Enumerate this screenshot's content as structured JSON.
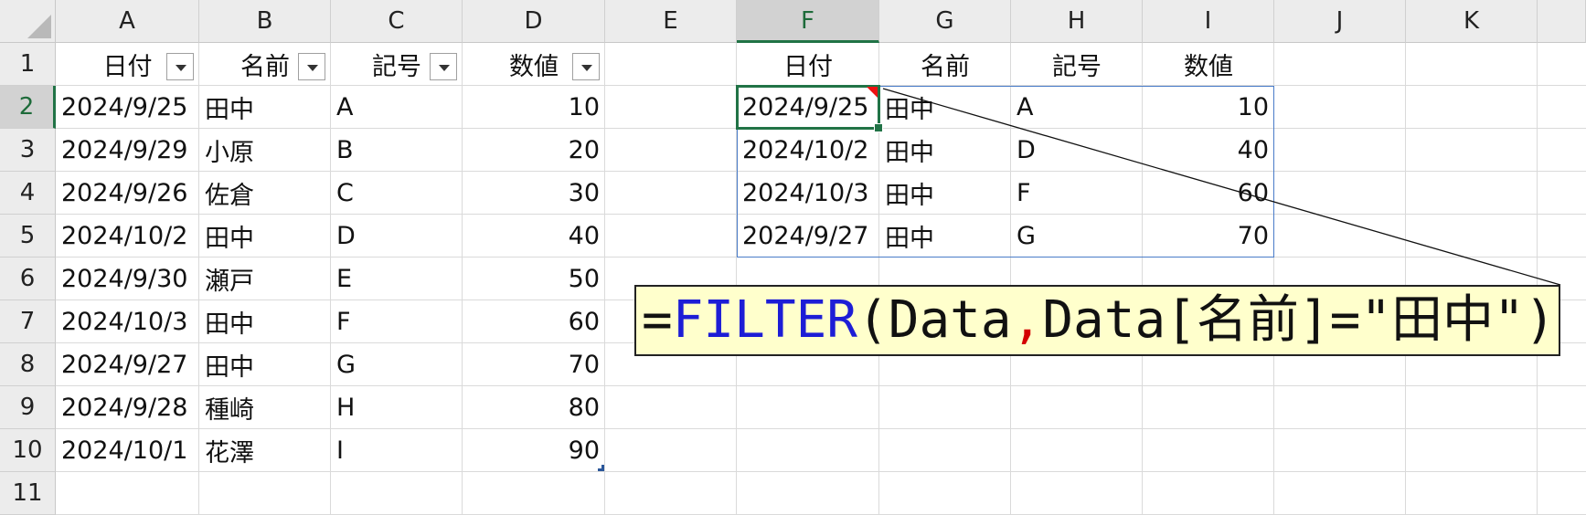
{
  "columns": [
    "A",
    "B",
    "C",
    "D",
    "E",
    "F",
    "G",
    "H",
    "I",
    "J",
    "K"
  ],
  "rows": [
    "1",
    "2",
    "3",
    "4",
    "5",
    "6",
    "7",
    "8",
    "9",
    "10",
    "11"
  ],
  "selected": {
    "column": "F",
    "row": "2"
  },
  "source_table": {
    "headers": [
      "日付",
      "名前",
      "記号",
      "数値"
    ],
    "rows": [
      [
        "2024/9/25",
        "田中",
        "A",
        "10"
      ],
      [
        "2024/9/29",
        "小原",
        "B",
        "20"
      ],
      [
        "2024/9/26",
        "佐倉",
        "C",
        "30"
      ],
      [
        "2024/10/2",
        "田中",
        "D",
        "40"
      ],
      [
        "2024/9/30",
        "瀬戸",
        "E",
        "50"
      ],
      [
        "2024/10/3",
        "田中",
        "F",
        "60"
      ],
      [
        "2024/9/27",
        "田中",
        "G",
        "70"
      ],
      [
        "2024/9/28",
        "種崎",
        "H",
        "80"
      ],
      [
        "2024/10/1",
        "花澤",
        "I",
        "90"
      ]
    ]
  },
  "result_table": {
    "headers": [
      "日付",
      "名前",
      "記号",
      "数値"
    ],
    "rows": [
      [
        "2024/9/25",
        "田中",
        "A",
        "10"
      ],
      [
        "2024/10/2",
        "田中",
        "D",
        "40"
      ],
      [
        "2024/10/3",
        "田中",
        "F",
        "60"
      ],
      [
        "2024/9/27",
        "田中",
        "G",
        "70"
      ]
    ]
  },
  "formula": {
    "eq": "=",
    "fn": "FILTER",
    "open": "(",
    "arg1": "Data",
    "comma": ",",
    "arg2": "Data[名前]=\"田中\"",
    "close": ")"
  },
  "colors": {
    "function": "#1d1dd6",
    "comma": "#d40000",
    "callout_bg": "#ffffcc",
    "selection": "#217346",
    "spill_border": "#4a7cc9"
  }
}
